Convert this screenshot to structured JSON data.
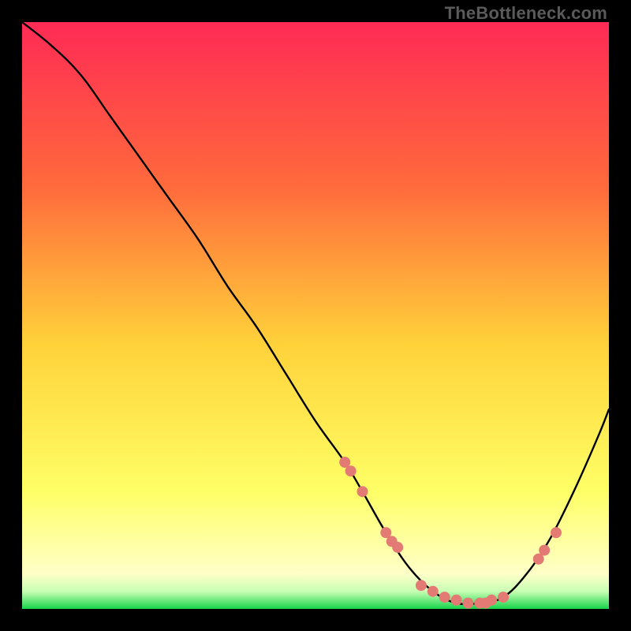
{
  "watermark": "TheBottleneck.com",
  "colors": {
    "background": "#000000",
    "gradient_top": "#ff2a55",
    "gradient_mid1": "#ff6a3c",
    "gradient_mid2": "#ffd23a",
    "gradient_low": "#ffff66",
    "gradient_pale": "#ffffc8",
    "green_light": "#c8ffb4",
    "green_dark": "#17d34b",
    "curve": "#000000",
    "dot": "#e47a74"
  },
  "chart_data": {
    "type": "line",
    "title": "",
    "xlabel": "",
    "ylabel": "",
    "xlim": [
      0,
      100
    ],
    "ylim": [
      0,
      100
    ],
    "series": [
      {
        "name": "bottleneck-curve",
        "x": [
          0,
          5,
          10,
          15,
          20,
          25,
          30,
          35,
          40,
          45,
          50,
          55,
          58,
          62,
          66,
          70,
          74,
          78,
          82,
          86,
          90,
          94,
          98,
          100
        ],
        "y": [
          100,
          96,
          91,
          84,
          77,
          70,
          63,
          55,
          48,
          40,
          32,
          25,
          20,
          13,
          7,
          3,
          1,
          1,
          2,
          6,
          12,
          20,
          29,
          34
        ]
      }
    ],
    "highlight_dots": {
      "name": "gpu-points",
      "x": [
        55,
        56,
        58,
        62,
        63,
        64,
        68,
        70,
        72,
        74,
        76,
        78,
        79,
        80,
        82,
        88,
        89,
        91
      ],
      "y": [
        25,
        23.5,
        20,
        13,
        11.5,
        10.5,
        4,
        3,
        2,
        1.5,
        1,
        1,
        1,
        1.5,
        2,
        8.5,
        10,
        13
      ]
    },
    "green_zone_y": [
      0,
      2.2
    ]
  }
}
